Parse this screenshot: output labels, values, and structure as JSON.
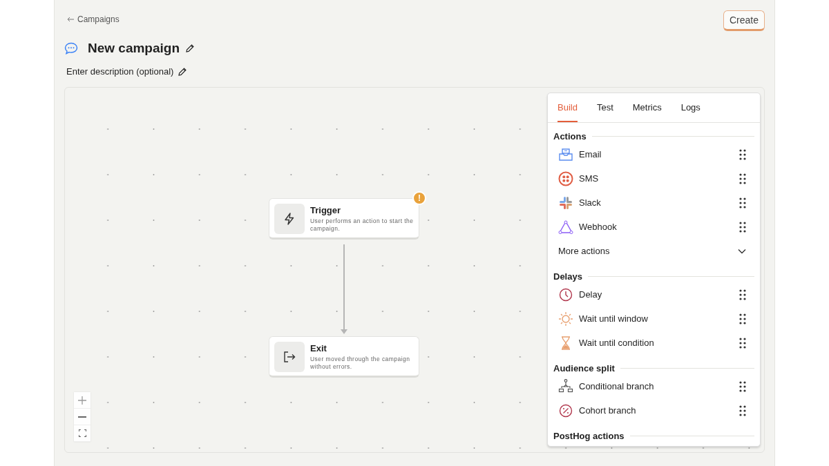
{
  "breadcrumb": {
    "label": "Campaigns"
  },
  "title": "New campaign",
  "description": "Enter description (optional)",
  "create_button": "Create",
  "nodes": [
    {
      "kind": "trigger",
      "title": "Trigger",
      "text": "User performs an action to start the campaign.",
      "warning": true,
      "warning_mark": "!"
    },
    {
      "kind": "exit",
      "title": "Exit",
      "text": "User moved through the campaign without errors.",
      "warning": false
    }
  ],
  "panel": {
    "tabs": [
      {
        "label": "Build",
        "selected": true
      },
      {
        "label": "Test",
        "selected": false
      },
      {
        "label": "Metrics",
        "selected": false
      },
      {
        "label": "Logs",
        "selected": false
      }
    ],
    "sections": [
      {
        "title": "Actions",
        "items": [
          {
            "kind": "email",
            "label": "Email"
          },
          {
            "kind": "sms",
            "label": "SMS"
          },
          {
            "kind": "slack",
            "label": "Slack"
          },
          {
            "kind": "webhook",
            "label": "Webhook"
          }
        ],
        "more": {
          "label": "More actions",
          "expanded": false
        }
      },
      {
        "title": "Delays",
        "items": [
          {
            "kind": "delay",
            "label": "Delay"
          },
          {
            "kind": "window",
            "label": "Wait until window"
          },
          {
            "kind": "condition",
            "label": "Wait until condition"
          }
        ]
      },
      {
        "title": "Audience split",
        "items": [
          {
            "kind": "branch",
            "label": "Conditional branch"
          },
          {
            "kind": "cohort",
            "label": "Cohort branch"
          }
        ]
      },
      {
        "title": "PostHog actions"
      }
    ]
  }
}
